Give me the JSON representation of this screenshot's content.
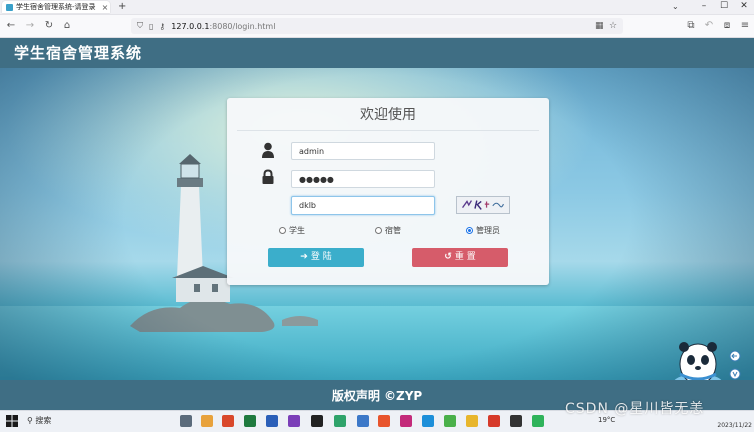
{
  "browser": {
    "tab_title": "学生宿舍管理系统-请登录",
    "tab_close": "×",
    "new_tab": "+",
    "url_host": "127.0.0.1",
    "url_rest": ":8080/login.html"
  },
  "page": {
    "site_title": "学生宿舍管理系统",
    "footer": "版权声明 ©ZYP"
  },
  "login": {
    "title": "欢迎使用",
    "username": {
      "value": "admin"
    },
    "password": {
      "value": "●●●●●"
    },
    "captcha_input": {
      "value": "dklb"
    },
    "roles": [
      {
        "label": "学生",
        "checked": false
      },
      {
        "label": "宿管",
        "checked": false
      },
      {
        "label": "管理员",
        "checked": true
      }
    ],
    "login_button": {
      "icon": "➔",
      "label": "登 陆"
    },
    "reset_button": {
      "icon": "↺",
      "label": "重 置"
    }
  },
  "taskbar": {
    "search_label": "搜索",
    "weather": "19°C",
    "clock_date": "2023/11/22"
  },
  "overlay": {
    "watermark": "CSDN @星川皆无恙"
  },
  "colors": {
    "header_bg": "#3f6e84",
    "login_btn": "#3baecb",
    "reset_btn": "#d65c6a",
    "radio_checked": "#1a73e8"
  },
  "icons": [
    "tab-favicon-icon",
    "back-arrow-icon",
    "forward-arrow-icon",
    "reload-icon",
    "home-icon",
    "shield-icon",
    "page-icon",
    "key-icon",
    "qr-icon",
    "star-icon",
    "crop-icon",
    "undo-icon",
    "extensions-icon",
    "menu-icon",
    "user-icon",
    "lock-icon",
    "arrow-right-icon",
    "reset-icon",
    "windows-start-icon",
    "search-icon"
  ]
}
